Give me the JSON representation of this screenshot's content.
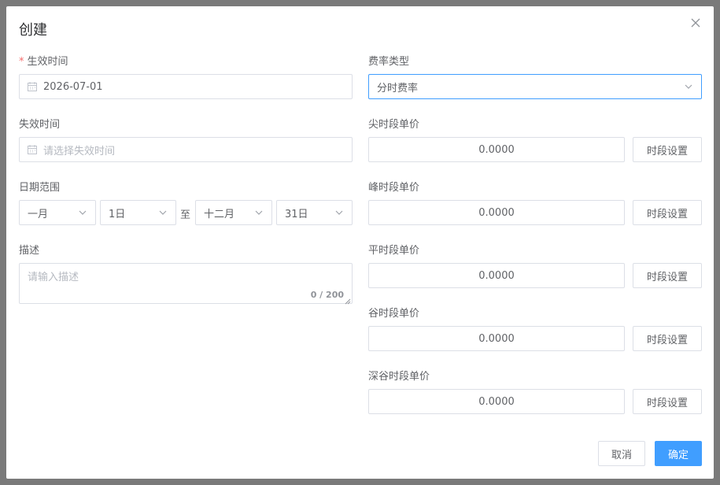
{
  "dialog": {
    "title": "创建",
    "close_icon": "close-icon"
  },
  "form": {
    "effective_time": {
      "label": "生效时间",
      "required": "*",
      "value": "2026-07-01",
      "icon": "calendar-icon"
    },
    "expire_time": {
      "label": "失效时间",
      "placeholder": "请选择失效时间",
      "icon": "calendar-icon"
    },
    "date_range": {
      "label": "日期范围",
      "start_month": "一月",
      "start_day": "1日",
      "separator": "至",
      "end_month": "十二月",
      "end_day": "31日"
    },
    "description": {
      "label": "描述",
      "placeholder": "请输入描述",
      "counter": "0 / 200"
    },
    "rate_type": {
      "label": "费率类型",
      "value": "分时费率"
    },
    "prices": [
      {
        "label": "尖时段单价",
        "value": "0.0000",
        "button": "时段设置"
      },
      {
        "label": "峰时段单价",
        "value": "0.0000",
        "button": "时段设置"
      },
      {
        "label": "平时段单价",
        "value": "0.0000",
        "button": "时段设置"
      },
      {
        "label": "谷时段单价",
        "value": "0.0000",
        "button": "时段设置"
      },
      {
        "label": "深谷时段单价",
        "value": "0.0000",
        "button": "时段设置"
      }
    ]
  },
  "footer": {
    "cancel_label": "取消",
    "confirm_label": "确定"
  },
  "colors": {
    "primary": "#409eff",
    "required": "#f56c6c",
    "border": "#dcdfe6",
    "overlay": "#7a7a7a"
  }
}
